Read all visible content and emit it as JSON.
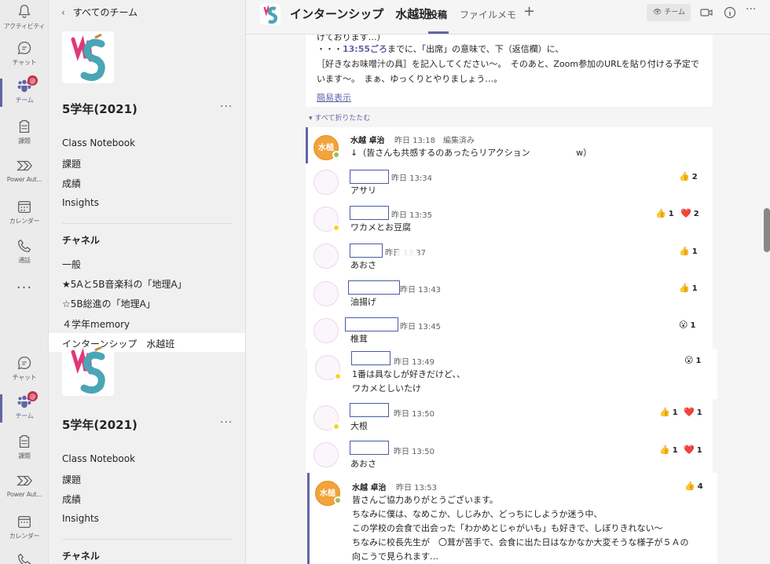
{
  "rail": {
    "items": [
      {
        "label": "アクティビティ",
        "icon": "bell-icon"
      },
      {
        "label": "チャット",
        "icon": "chat-icon"
      },
      {
        "label": "チーム",
        "icon": "teams-icon",
        "badge": "@"
      },
      {
        "label": "課題",
        "icon": "assignments-icon"
      },
      {
        "label": "Power Aut...",
        "icon": "power-automate-icon"
      },
      {
        "label": "カレンダー",
        "icon": "calendar-icon"
      },
      {
        "label": "通話",
        "icon": "phone-icon"
      },
      {
        "label": "チャット",
        "icon": "chat-icon"
      },
      {
        "label": "チーム",
        "icon": "teams-icon",
        "badge": "@"
      },
      {
        "label": "課題",
        "icon": "assignments-icon"
      },
      {
        "label": "Power Aut...",
        "icon": "power-automate-icon"
      },
      {
        "label": "カレンダー",
        "icon": "calendar-icon"
      }
    ],
    "more": "···"
  },
  "pane": {
    "back_label": "すべてのチーム",
    "team_name": "5学年(2021)",
    "more": "···",
    "links": [
      "Class Notebook",
      "課題",
      "成績",
      "Insights"
    ],
    "channels_heading": "チャネル",
    "channels": [
      "一般",
      "★5Aと5B音楽科の「地理A」",
      "☆5B総進の「地理A」",
      "４学年memory",
      "インターンシップ　水越班"
    ],
    "team_name_2": "5学年(2021)",
    "links_2": [
      "Class Notebook",
      "課題",
      "成績",
      "Insights"
    ],
    "channels_heading_2": "チャネル"
  },
  "header": {
    "title": "インターンシップ　水越班",
    "tabs": [
      "投稿",
      "ファイル",
      "メモ"
    ],
    "add": "+",
    "team_chip": "チーム"
  },
  "post": {
    "line1": "けております…）",
    "line2_prefix": "・・・",
    "line2_time": "13:55ごろ",
    "line2_rest": "までに、「出席」の意味で、下（返信欄）に、",
    "line3": "［好きなお味噌汁の具］を記入してください〜。　そのあと、Zoom参加のURLを貼り付ける予定で",
    "line4": "います〜。　まぁ、ゆっくりとやりましょう…。",
    "less": "簡易表示",
    "collapse_all": "すべて折りたたむ"
  },
  "replies": [
    {
      "author": "水越 卓治",
      "time": "昨日 13:18　編集済み",
      "text": "↓（皆さんも共感するのあったらリアクション　　　　　 w）",
      "avatar_text": "水槌",
      "reactions": []
    },
    {
      "author": "",
      "time": "昨日 13:34",
      "text": "アサリ",
      "reactions": [
        {
          "emoji": "👍",
          "count": "2"
        }
      ]
    },
    {
      "author": "",
      "time": "昨日 13:35",
      "text": "ワカメとお豆腐",
      "reactions": [
        {
          "emoji": "👍",
          "count": "1"
        },
        {
          "emoji": "❤️",
          "count": "2"
        }
      ]
    },
    {
      "author": "",
      "time": "昨日 13:37",
      "text": "あおさ",
      "reactions": [
        {
          "emoji": "👍",
          "count": "1"
        }
      ]
    },
    {
      "author": "",
      "time": "昨日 13:43",
      "text": "油揚げ",
      "reactions": [
        {
          "emoji": "👍",
          "count": "1"
        }
      ]
    },
    {
      "author": "",
      "time": "昨日 13:45",
      "text": "椎茸",
      "reactions": [
        {
          "emoji": "😮",
          "count": "1"
        }
      ]
    },
    {
      "author": "",
      "time": "昨日 13:49",
      "text": "1番は具なしが好きだけど、、",
      "text2": "ワカメとしいたけ",
      "reactions": [
        {
          "emoji": "😮",
          "count": "1"
        }
      ]
    },
    {
      "author": "",
      "time": "昨日 13:50",
      "text": "大根",
      "reactions": [
        {
          "emoji": "👍",
          "count": "1"
        },
        {
          "emoji": "❤️",
          "count": "1"
        }
      ]
    },
    {
      "author": "",
      "time": "昨日 13:50",
      "text": "あおさ",
      "reactions": [
        {
          "emoji": "👍",
          "count": "1"
        },
        {
          "emoji": "❤️",
          "count": "1"
        }
      ]
    },
    {
      "author": "水越 卓治",
      "time": "昨日 13:53",
      "avatar_text": "水槌",
      "lines": [
        "皆さんご協力ありがとうございます。",
        "ちなみに僕は、なめこか、しじみか、どっちにしようか迷う中、",
        "この学校の会食で出会った「わかめとじゃがいも」も好きで、しぼりきれない〜",
        "ちなみに校長先生が　〇茸が苦手で、会食に出た日はなかなか大変そうな様子が５Ａの",
        "向こうで見られます…"
      ],
      "reactions": [
        {
          "emoji": "👍",
          "count": "4"
        }
      ]
    }
  ],
  "colors": {
    "accent": "#6264a7",
    "badge": "#c4314b",
    "rail_bg": "#ebebeb"
  }
}
